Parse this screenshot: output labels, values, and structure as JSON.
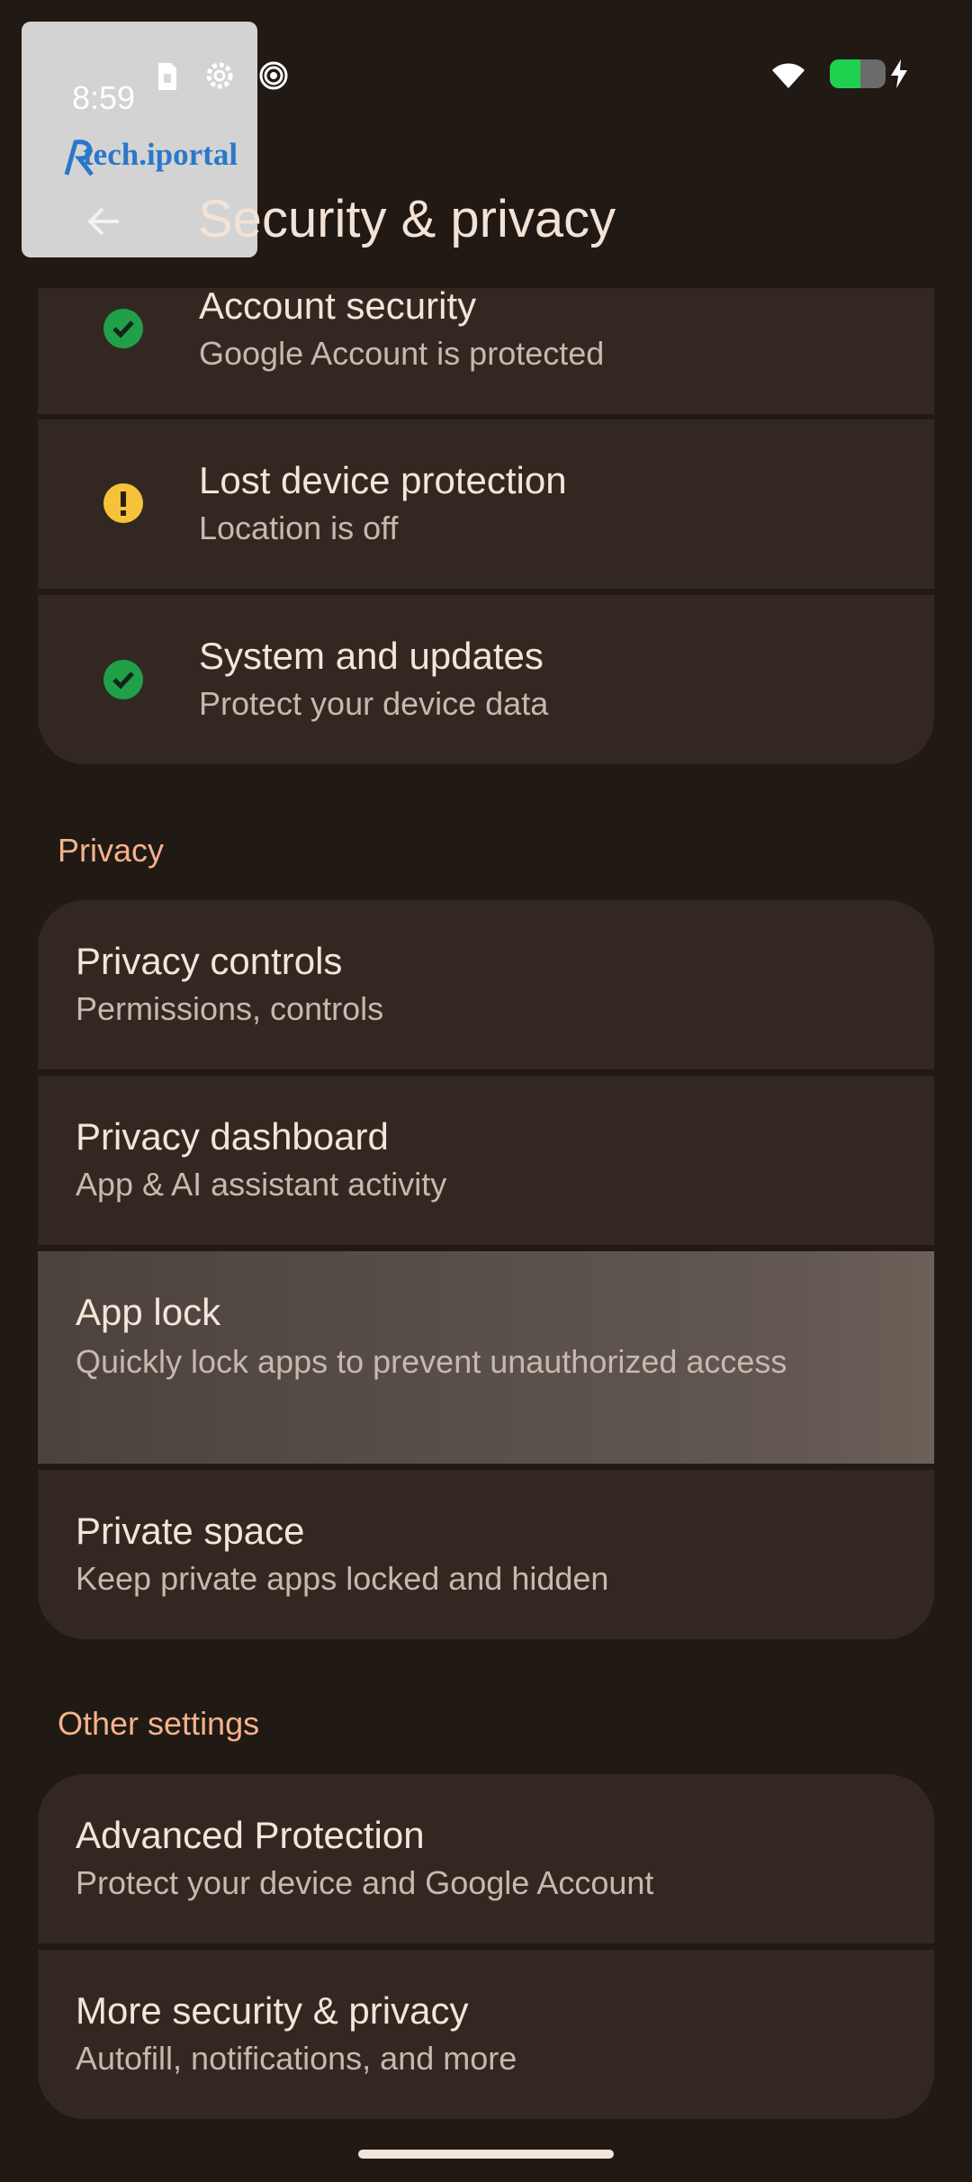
{
  "status_bar": {
    "time": "8:59",
    "icons": [
      "sim-icon",
      "settings-gear-icon",
      "spiral-icon",
      "wifi-icon",
      "battery-charging-icon"
    ],
    "battery_level": 0.55,
    "battery_color": "#1fd04f"
  },
  "watermark": {
    "text": "tech.iportal",
    "color": "#2a78c8"
  },
  "header": {
    "title": "Security & privacy",
    "back_icon": "back-arrow-icon"
  },
  "security_items": [
    {
      "title": "Account security",
      "subtitle": "Google Account is protected",
      "status": "ok",
      "status_color": "#1fa049"
    },
    {
      "title": "Lost device protection",
      "subtitle": "Location is off",
      "status": "warning",
      "status_color": "#f6c23a"
    },
    {
      "title": "System and updates",
      "subtitle": "Protect your device data",
      "status": "ok",
      "status_color": "#1fa049"
    }
  ],
  "privacy": {
    "header": "Privacy",
    "items": [
      {
        "title": "Privacy controls",
        "subtitle": "Permissions, controls"
      },
      {
        "title": "Privacy dashboard",
        "subtitle": "App & AI assistant activity"
      },
      {
        "title": "App lock",
        "subtitle": "Quickly lock apps to prevent unauthorized access"
      },
      {
        "title": "Private space",
        "subtitle": "Keep private apps locked and hidden"
      }
    ]
  },
  "other_settings": {
    "header": "Other settings",
    "items": [
      {
        "title": "Advanced Protection",
        "subtitle": "Protect your device and Google Account"
      },
      {
        "title": "More security & privacy",
        "subtitle": "Autofill, notifications, and more"
      }
    ]
  },
  "colors": {
    "background": "#201914",
    "card": "#332821",
    "accent_header": "#f4b28c"
  }
}
